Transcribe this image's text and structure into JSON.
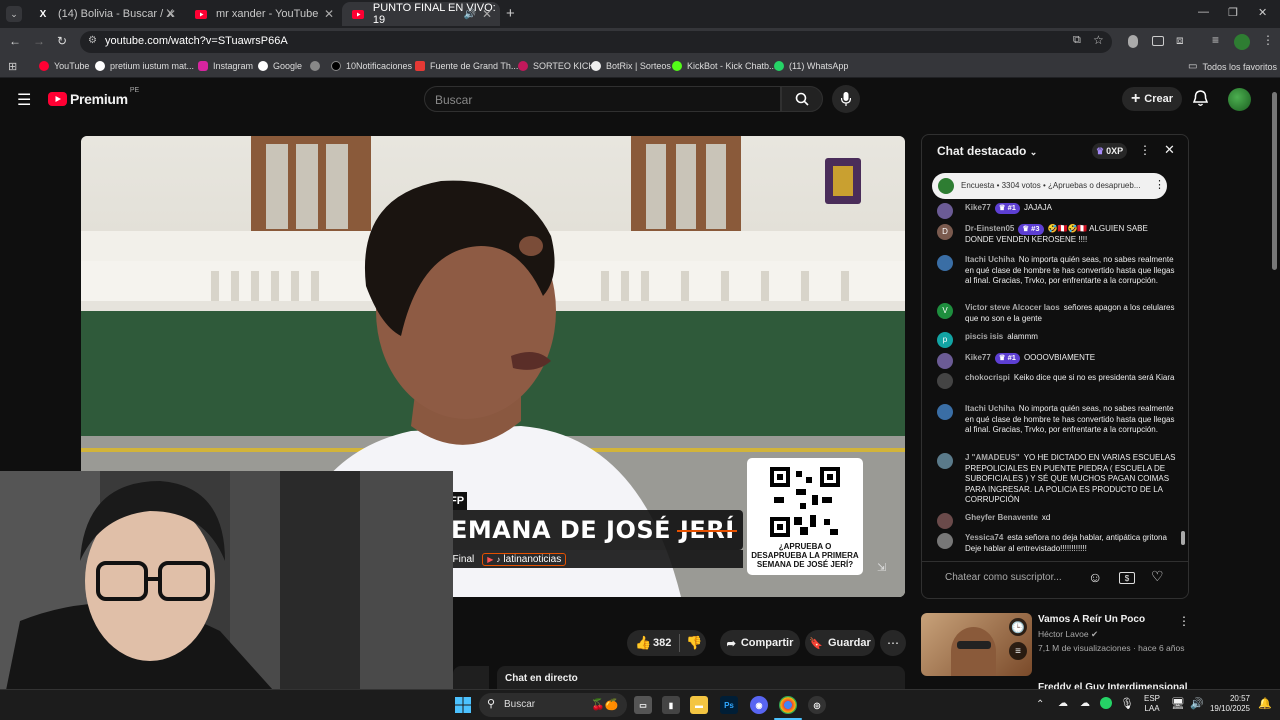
{
  "browser": {
    "tabs": [
      {
        "title": "(14) Bolivia - Buscar / X",
        "icon": "x-icon"
      },
      {
        "title": "mr xander - YouTube",
        "icon": "youtube-icon"
      },
      {
        "title": "PUNTO FINAL EN VIVO: 19",
        "icon": "youtube-icon"
      }
    ],
    "new_tab": "+",
    "url": "youtube.com/watch?v=STuawrsP66A",
    "bookmarks": [
      "YouTube",
      "pretium iustum mat...",
      "Instagram",
      "Google",
      "10Notificaciones",
      "Fuente de Grand Th...",
      "SORTEO KICK",
      "BotRix | Sorteos",
      "KickBot - Kick Chatb...",
      "(11) WhatsApp"
    ],
    "all_bookmarks": "Todos los favoritos"
  },
  "youtube": {
    "logo": "Premium",
    "region": "PE",
    "search_placeholder": "Buscar",
    "create_label": "Crear"
  },
  "video": {
    "lower_third": "EMANA DE JOSÉ JERÍ",
    "lower_tag": "FP",
    "handle_left": "oFinal",
    "handle_right": "latinanoticias",
    "qr_caption": "¿APRUEBA O DESAPRUEBA LA PRIMERA SEMANA DE JOSÉ JERÍ?"
  },
  "actions": {
    "likes": "382",
    "share": "Compartir",
    "save": "Guardar"
  },
  "live_chat_label": "Chat en directo",
  "chat": {
    "title": "Chat destacado",
    "xp": "0XP",
    "poll": "Encuesta • 3304 votos • ¿Apruebas o desaprueb...",
    "messages": [
      {
        "author": "Kike77",
        "badge": "#1",
        "text": "JAJAJA",
        "avatar_color": "#6b5b95",
        "initial": ""
      },
      {
        "author": "Dr-Einsten05",
        "badge": "#3",
        "text": "🤣🇵🇪🤣🇵🇪 ALGUIEN SABE DONDE VENDEN KEROSENE !!!!",
        "avatar_color": "#7a5a4e",
        "initial": "D"
      },
      {
        "author": "Itachi Uchiha",
        "badge": "",
        "text": "No importa quién seas, no sabes realmente en qué clase de hombre te has convertido hasta que llegas al final. Gracias, Trvko, por enfrentarte a la corrupción.",
        "avatar_color": "#3a6ea5",
        "initial": ""
      },
      {
        "author": "Victor steve Alcocer laos",
        "badge": "",
        "text": "señores apagon a los celulares que no son e la gente",
        "avatar_color": "#1e8e3e",
        "initial": "V"
      },
      {
        "author": "piscis isis",
        "badge": "",
        "text": "alammm",
        "avatar_color": "#12a4a4",
        "initial": "p"
      },
      {
        "author": "Kike77",
        "badge": "#1",
        "text": "OOOOVBIAMENTE",
        "avatar_color": "#6b5b95",
        "initial": ""
      },
      {
        "author": "chokocrispi",
        "badge": "",
        "text": "Keiko dice que si no es presidenta será Kiara",
        "avatar_color": "#444",
        "initial": ""
      },
      {
        "author": "Itachi Uchiha",
        "badge": "",
        "text": "No importa quién seas, no sabes realmente en qué clase de hombre te has convertido hasta que llegas al final. Gracias, Trvko, por enfrentarte a la corrupción.",
        "avatar_color": "#3a6ea5",
        "initial": ""
      },
      {
        "author": "J \"AMADEUS\"",
        "badge": "",
        "text": "YO HE DICTADO EN VARIAS ESCUELAS PREPOLICIALES EN PUENTE PIEDRA ( ESCUELA DE SUBOFICIALES ) Y SÉ QUE MUCHOS PAGAN COIMAS PARA INGRESAR. LA POLICIA ES PRODUCTO DE LA CORRUPCIÓN",
        "avatar_color": "#5a7a8a",
        "initial": ""
      },
      {
        "author": "Gheyfer Benavente",
        "badge": "",
        "text": "xd",
        "avatar_color": "#6a4a4a",
        "initial": ""
      },
      {
        "author": "Yessica74",
        "badge": "",
        "text": "esta señora no deja hablar, antipática gritona Deje hablar al entrevistado!!!!!!!!!!!!",
        "avatar_color": "#777",
        "initial": ""
      }
    ],
    "input_placeholder": "Chatear como suscriptor..."
  },
  "recommendation": {
    "title": "Vamos A Reír Un Poco",
    "channel": "Héctor Lavoe",
    "meta": "7,1 M de visualizaciones · hace 6 años",
    "next_title": "Freddy el Guy Interdimensional"
  },
  "taskbar": {
    "search": "Buscar",
    "lang": "ESP",
    "lang2": "LAA",
    "time": "20:57",
    "date": "19/10/2025"
  }
}
